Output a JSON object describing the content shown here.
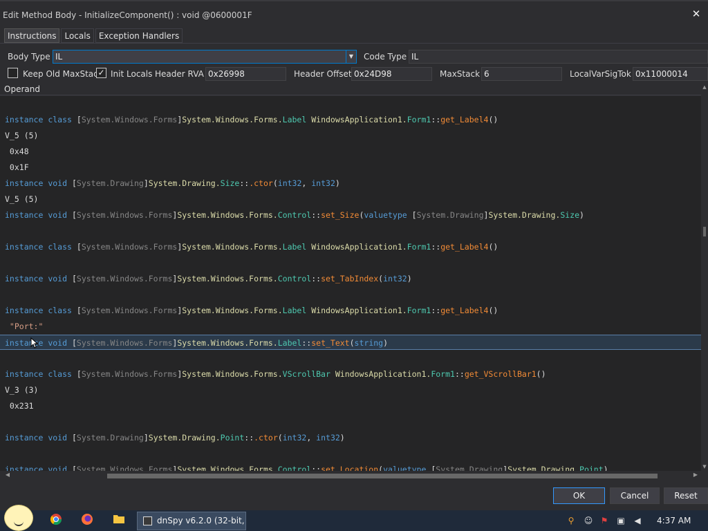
{
  "window": {
    "title": "Edit Method Body - InitializeComponent() : void @0600001F",
    "close_glyph": "✕"
  },
  "tabs": [
    {
      "label": "Instructions",
      "active": true
    },
    {
      "label": "Locals",
      "active": false
    },
    {
      "label": "Exception Handlers",
      "active": false
    }
  ],
  "form": {
    "body_type_label": "Body Type",
    "body_type_value": "IL",
    "code_type_label": "Code Type",
    "code_type_value": "IL",
    "keep_old_maxstack_label": "Keep Old MaxStack",
    "keep_old_maxstack_checked": false,
    "init_locals_label": "Init Locals",
    "init_locals_checked": true,
    "header_rva_label": "Header RVA",
    "header_rva_value": "0x26998",
    "header_offset_label": "Header Offset",
    "header_offset_value": "0x24D98",
    "maxstack_label": "MaxStack",
    "maxstack_value": "6",
    "localvarsigtok_label": "LocalVarSigTok",
    "localvarsigtok_value": "0x11000014"
  },
  "grid": {
    "operand_header": "Operand",
    "selected_row": 14
  },
  "buttons": {
    "ok": "OK",
    "cancel": "Cancel",
    "reset": "Reset"
  },
  "taskbar": {
    "app_label": "dnSpy v6.2.0 (32-bit, ...",
    "clock": "4:37 AM",
    "icons": [
      "avatar-icon",
      "chrome-icon",
      "firefox-icon",
      "folder-icon",
      "dnspy-icon"
    ],
    "tray_icons": [
      "search-icon",
      "smiley-icon",
      "flag-icon",
      "network-icon",
      "volume-icon"
    ]
  },
  "colors": {
    "accent": "#007acc",
    "keyword": "#569cd6",
    "assembly": "#868686",
    "type": "#4ec9b0",
    "method": "#f28b36",
    "background": "#252526"
  }
}
